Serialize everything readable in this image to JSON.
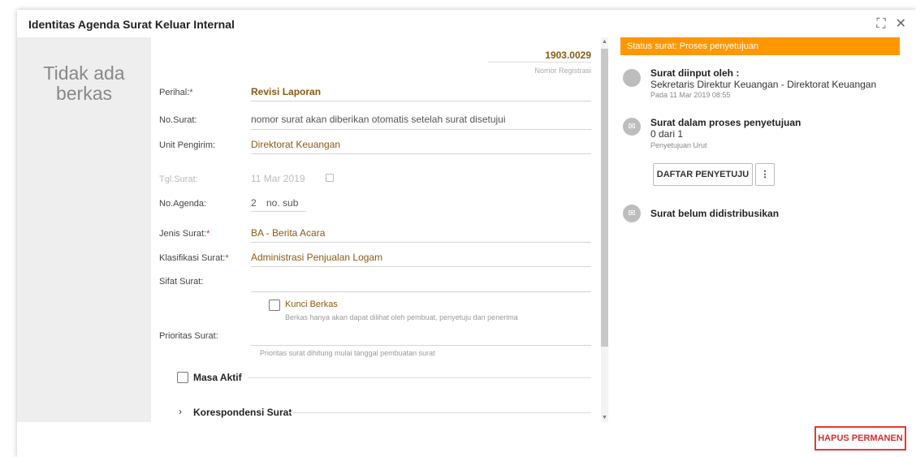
{
  "dialog": {
    "title": "Identitas Agenda Surat Keluar Internal"
  },
  "left_panel": {
    "line1": "Tidak ada",
    "line2": "berkas"
  },
  "registration": {
    "number": "1903.0029",
    "label": "Nomor Registrasi"
  },
  "form": {
    "perihal": {
      "label": "Perihal:",
      "value": "Revisi Laporan"
    },
    "no_surat": {
      "label": "No.Surat:",
      "value": "nomor surat akan diberikan otomatis setelah surat disetujui"
    },
    "unit_pengirim": {
      "label": "Unit Pengirim:",
      "value": "Direktorat Keuangan"
    },
    "tgl_surat": {
      "label": "Tgl.Surat:",
      "value": "11 Mar 2019"
    },
    "no_agenda": {
      "label": "No.Agenda:",
      "value": "2",
      "sub_placeholder": "no. sub"
    },
    "jenis_surat": {
      "label": "Jenis Surat:",
      "value": "BA - Berita Acara"
    },
    "klasifikasi_surat": {
      "label": "Klasifikasi Surat:",
      "value": "Administrasi Penjualan Logam"
    },
    "sifat_surat": {
      "label": "Sifat Surat:",
      "value": ""
    },
    "kunci_berkas": {
      "label": "Kunci Berkas",
      "hint": "Berkas hanya akan dapat dilihat oleh pembuat, penyetuju dan penerima"
    },
    "prioritas_surat": {
      "label": "Prioritas Surat:",
      "hint": "Prioritas surat dihitung mulai tanggal pembuatan surat"
    },
    "masa_aktif": {
      "label": "Masa Aktif"
    },
    "korespondensi": {
      "label": "Korespondensi Surat"
    }
  },
  "status": {
    "bar": "Status surat: Proses penyetujuan",
    "input": {
      "title": "Surat diinput oleh :",
      "by": "Sekretaris Direktur Keuangan - Direktorat Keuangan",
      "time": "Pada 11 Mar 2019 08:55"
    },
    "approval": {
      "title": "Surat dalam proses penyetujuan",
      "count": "0 dari 1",
      "type": "Penyetujuan Urut",
      "button": "DAFTAR PENYETUJU"
    },
    "distribution": {
      "title": "Surat belum didistribusikan"
    }
  },
  "footer": {
    "delete_button": "HAPUS PERMANEN"
  },
  "colors": {
    "accent": "#ff9800",
    "value_text": "#8a5a14",
    "danger": "#d32f2f"
  }
}
